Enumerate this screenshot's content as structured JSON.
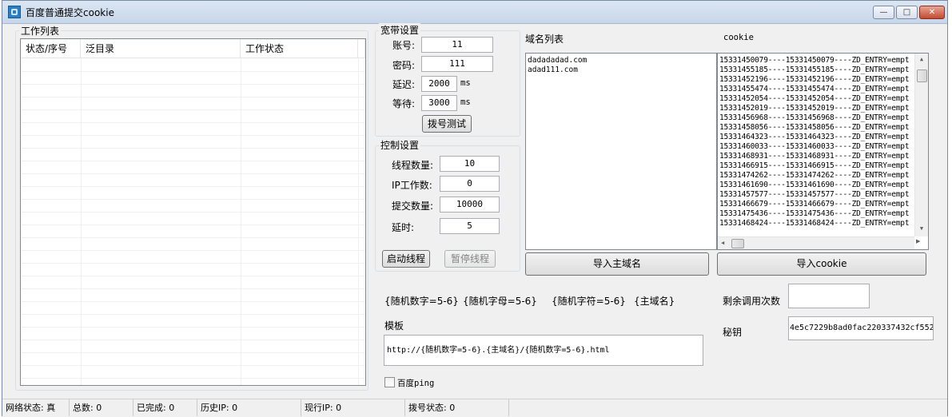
{
  "window": {
    "title": "百度普通提交cookie",
    "minimize": "—",
    "maximize": "□",
    "close": "✕"
  },
  "worklist": {
    "group_label": "工作列表",
    "columns": [
      "状态/序号",
      "泛目录",
      "工作状态"
    ]
  },
  "broadband": {
    "group_label": "宽带设置",
    "account_label": "账号:",
    "account_value": "11",
    "password_label": "密码:",
    "password_value": "111",
    "delay_label": "延迟:",
    "delay_value": "2000",
    "delay_unit": "ms",
    "wait_label": "等待:",
    "wait_value": "3000",
    "wait_unit": "ms",
    "dial_test_button": "拨号测试"
  },
  "control": {
    "group_label": "控制设置",
    "threads_label": "线程数量:",
    "threads_value": "10",
    "ip_work_label": "IP工作数:",
    "ip_work_value": "0",
    "submit_count_label": "提交数量:",
    "submit_count_value": "10000",
    "delay_label": "延时:",
    "delay_value": "5",
    "start_button": "启动线程",
    "pause_button": "暂停线程"
  },
  "domains": {
    "label": "域名列表",
    "items": [
      "dadadadad.com",
      "adad111.com"
    ],
    "import_button": "导入主域名"
  },
  "cookies": {
    "label": "cookie",
    "items": [
      "15331450079----15331450079----ZD_ENTRY=empt",
      "15331455185----15331455185----ZD_ENTRY=empt",
      "15331452196----15331452196----ZD_ENTRY=empt",
      "15331455474----15331455474----ZD_ENTRY=empt",
      "15331452054----15331452054----ZD_ENTRY=empt",
      "15331452019----15331452019----ZD_ENTRY=empt",
      "15331456968----15331456968----ZD_ENTRY=empt",
      "15331458056----15331458056----ZD_ENTRY=empt",
      "15331464323----15331464323----ZD_ENTRY=empt",
      "15331460033----15331460033----ZD_ENTRY=empt",
      "15331468931----15331468931----ZD_ENTRY=empt",
      "15331466915----15331466915----ZD_ENTRY=empt",
      "15331474262----15331474262----ZD_ENTRY=empt",
      "15331461690----15331461690----ZD_ENTRY=empt",
      "15331457577----15331457577----ZD_ENTRY=empt",
      "15331466679----15331466679----ZD_ENTRY=empt",
      "15331475436----15331475436----ZD_ENTRY=empt",
      "15331468424----15331468424----ZD_ENTRY=empt"
    ],
    "import_button": "导入cookie"
  },
  "tokens": {
    "random_digits": "{随机数字=5-6}",
    "random_letters": "{随机字母=5-6}",
    "random_chars": "{随机字符=5-6}",
    "main_domain": "{主域名}"
  },
  "template": {
    "label": "模板",
    "value": "http://{随机数字=5-6}.{主域名}/{随机数字=5-6}.html"
  },
  "remaining": {
    "label": "剩余调用次数",
    "value": ""
  },
  "secret": {
    "label": "秘钥",
    "value": "4e5c7229b8ad0fac220337432cf552"
  },
  "baidu_ping": {
    "label": "百度ping",
    "checked": false
  },
  "status_bar": {
    "network": "网络状态: 真",
    "total": "总数: 0",
    "completed": "已完成: 0",
    "history_ip": "历史IP: 0",
    "current_ip": "现行IP: 0",
    "dial_status": "拨号状态: 0"
  },
  "colors": {
    "titlebar": "#c7d6ea",
    "close_button": "#c24b32",
    "window_bg": "#f0f0f0"
  }
}
